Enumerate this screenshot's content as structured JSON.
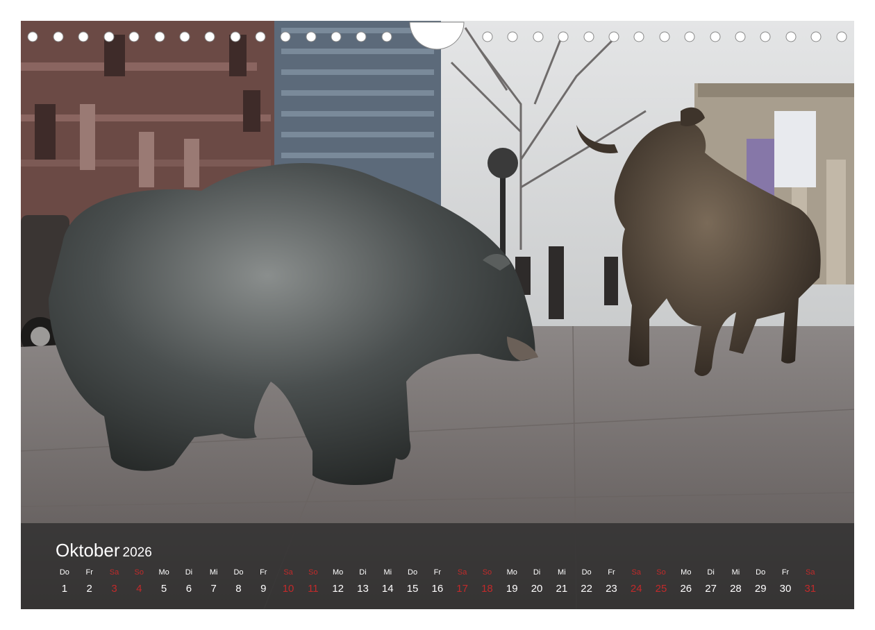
{
  "calendar": {
    "month": "Oktober",
    "year": "2026",
    "weekdays": [
      "Do",
      "Fr",
      "Sa",
      "So",
      "Mo",
      "Di",
      "Mi",
      "Do",
      "Fr",
      "Sa",
      "So",
      "Mo",
      "Di",
      "Mi",
      "Do",
      "Fr",
      "Sa",
      "So",
      "Mo",
      "Di",
      "Mi",
      "Do",
      "Fr",
      "Sa",
      "So",
      "Mo",
      "Di",
      "Mi",
      "Do",
      "Fr",
      "Sa"
    ],
    "days": [
      "1",
      "2",
      "3",
      "4",
      "5",
      "6",
      "7",
      "8",
      "9",
      "10",
      "11",
      "12",
      "13",
      "14",
      "15",
      "16",
      "17",
      "18",
      "19",
      "20",
      "21",
      "22",
      "23",
      "24",
      "25",
      "26",
      "27",
      "28",
      "29",
      "30",
      "31"
    ],
    "weekend_indices": [
      2,
      3,
      9,
      10,
      16,
      17,
      23,
      24,
      30
    ]
  },
  "colors": {
    "weekday_text": "#ffffff",
    "weekend_text": "#c22a2a",
    "bar_background": "#282828"
  }
}
